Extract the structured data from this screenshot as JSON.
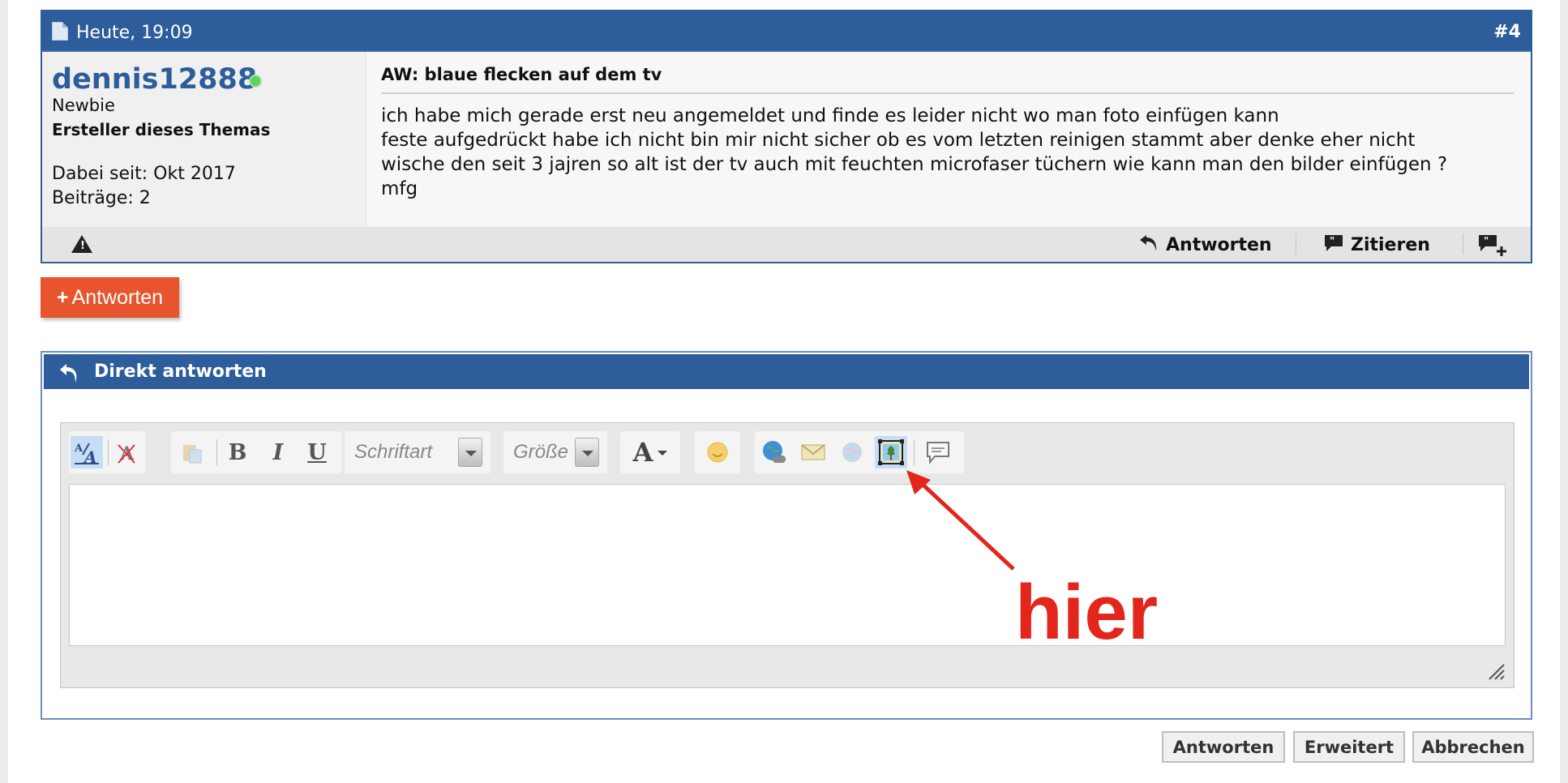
{
  "post": {
    "date": "Heute, 19:09",
    "number": "#4",
    "user": {
      "name": "dennis12888",
      "rank": "Newbie",
      "thread_owner": "Ersteller dieses Themas",
      "joined": "Dabei seit: Okt 2017",
      "posts": "Beiträge: 2",
      "online_color": "#5fcf5f"
    },
    "title": "AW: blaue flecken auf dem tv",
    "body_lines": [
      "ich habe mich gerade erst neu angemeldet und finde es leider nicht wo man foto einfügen kann",
      "feste aufgedrückt habe ich nicht bin mir nicht sicher ob es vom letzten reinigen stammt aber denke eher nicht",
      "wische den seit 3 jajren so alt ist der tv auch mit feuchten microfaser tüchern wie kann man den bilder einfügen ?",
      "mfg"
    ],
    "footer": {
      "reply_label": "Antworten",
      "quote_label": "Zitieren",
      "report_icon": "warning-icon",
      "multiquote_icon": "multiquote-icon"
    }
  },
  "reply_button": {
    "plus": "+",
    "label": "Antworten",
    "color": "#e8542e"
  },
  "quick_reply": {
    "title": "Direkt antworten",
    "toolbar": {
      "font_placeholder": "Schriftart",
      "size_placeholder": "Größe",
      "bold": "B",
      "italic": "I",
      "underline": "U",
      "text_color": "A"
    }
  },
  "annotation": {
    "text": "hier",
    "color": "#e2261c"
  },
  "buttons": {
    "submit": "Antworten",
    "advanced": "Erweitert",
    "cancel": "Abbrechen"
  },
  "colors": {
    "header": "#2d5d9a",
    "accent": "#e8542e"
  }
}
